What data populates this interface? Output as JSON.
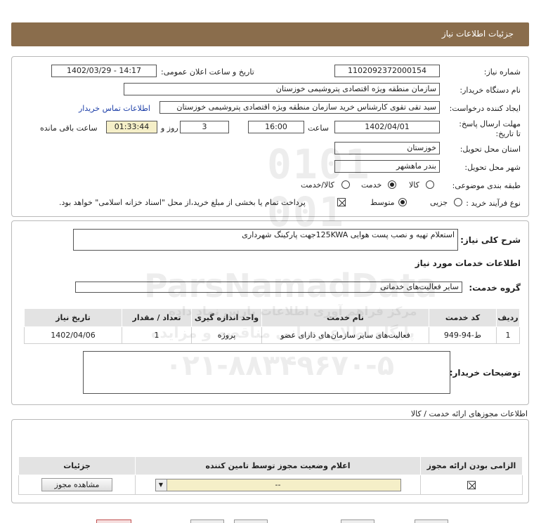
{
  "header": {
    "title": "جزئیات اطلاعات نیاز"
  },
  "form": {
    "need_number_label": "شماره نیاز:",
    "need_number": "1102092372000154",
    "announce_label": "تاریخ و ساعت اعلان عمومی:",
    "announce_value": "1402/03/29 - 14:17",
    "buyer_org_label": "نام دستگاه خریدار:",
    "buyer_org": "سازمان منطقه ویژه اقتصادی پتروشیمی خوزستان",
    "creator_label": "ایجاد کننده درخواست:",
    "creator": "سید تقی تقوی کارشناس خرید سازمان منطقه ویژه اقتصادی پتروشیمی خوزستان",
    "contact_link": "اطلاعات تماس خریدار",
    "deadline_label": "مهلت ارسال پاسخ: تا تاریخ:",
    "deadline_date": "1402/04/01",
    "time_label": "ساعت",
    "deadline_time": "16:00",
    "days_value": "3",
    "days_label": "روز و",
    "remaining_time": "01:33:44",
    "remaining_label": "ساعت باقی مانده",
    "province_label": "استان محل تحویل:",
    "province": "خوزستان",
    "city_label": "شهر محل تحویل:",
    "city": "بندر ماهشهر",
    "category_label": "طبقه بندی موضوعی:",
    "category_options": [
      "کالا",
      "خدمت",
      "کالا/خدمت"
    ],
    "category_selected": "خدمت",
    "process_label": "نوع فرآیند خرید :",
    "process_options": [
      "جزیی",
      "متوسط"
    ],
    "process_selected": "متوسط",
    "treasury_note": "پرداخت تمام یا بخشی از مبلغ خرید،از محل \"اسناد خزانه اسلامی\" خواهد بود."
  },
  "description": {
    "label": "شرح کلی نیاز:",
    "value": "استعلام تهیه و نصب  پست هوایی 125KWAجهت پارکینگ شهرداری"
  },
  "services": {
    "section_title": "اطلاعات خدمات مورد نیاز",
    "group_label": "گروه خدمت:",
    "group_value": "سایر فعالیت‌های خدماتی",
    "columns": [
      "ردیف",
      "کد خدمت",
      "نام خدمت",
      "واحد اندازه گیری",
      "تعداد / مقدار",
      "تاریخ نیاز"
    ],
    "rows": [
      [
        "1",
        "ط-94-949",
        "فعالیت‌های سایر سازمان‌های دارای عضو",
        "پروژه",
        "1",
        "1402/04/06"
      ]
    ]
  },
  "buyer_notes": {
    "label": "توضیحات خریدار:",
    "value": ""
  },
  "permits": {
    "title": "اطلاعات مجوزهای ارائه خدمت / کالا",
    "columns": [
      "الزامی بودن ارائه مجوز",
      "اعلام وضعیت مجوز توسط تامین کننده",
      "جزئیات"
    ],
    "select_value": "--",
    "view_button": "مشاهده مجوز"
  },
  "watermark": {
    "line1": "ParsNamadData",
    "line2": "مرکز فراهم آوری اطلاعات پارس نماد داده",
    "line3": "پایگاه اطلاع رسانی مناقصه و مزایده",
    "phone": "۰۲۱-۸۸۳۴۹۶۷۰-۵"
  },
  "colors": {
    "header": "#8a6d4c",
    "link": "#1d3fa8",
    "highlight": "#f5efc8"
  }
}
